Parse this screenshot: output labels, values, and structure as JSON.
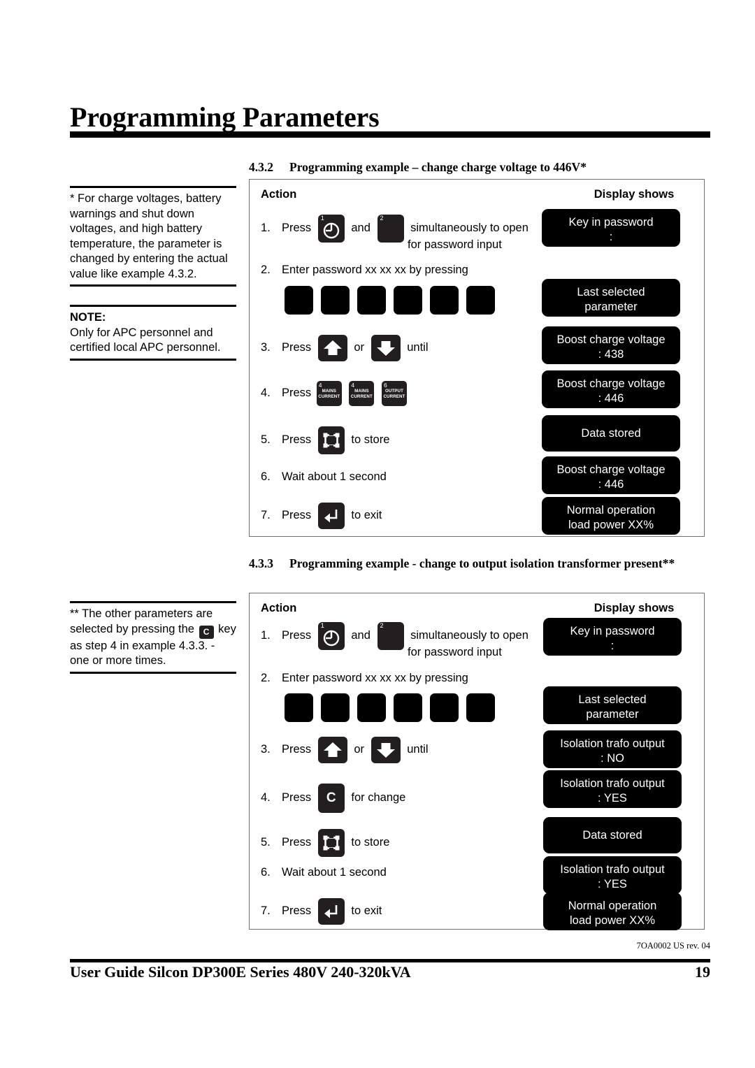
{
  "header": {
    "title": "Programming Parameters"
  },
  "side_notes": [
    {
      "id": "note-1",
      "text": "* For charge voltages, battery warnings and shut down voltages, and high battery temperature, the parameter is changed by entering the actual value like example 4.3.2."
    },
    {
      "id": "note-2",
      "label": "NOTE:",
      "text": "Only for APC personnel and certified local APC personnel."
    },
    {
      "id": "note-3",
      "text_before": "** The other parameters are selected by pressing the",
      "key_label": "C",
      "text_after": "key as step 4 in example 4.3.3. - one or more times."
    }
  ],
  "sections": [
    {
      "number": "4.3.2",
      "title": "Programming example – change charge voltage to 446V*"
    },
    {
      "number": "4.3.3",
      "title": "Programming example - change to output isolation transformer present**"
    }
  ],
  "table_headers": {
    "action": "Action",
    "display": "Display shows"
  },
  "table_432": {
    "steps": [
      {
        "num": "1.",
        "verb": "Press",
        "keys": [
          "power-clock-key-1",
          "blank-key-2"
        ],
        "conjunction": "and",
        "text_after": "simultaneously to open",
        "text_second_line": "for password input"
      },
      {
        "num": "2.",
        "text": "Enter password xx xx xx by pressing",
        "password_keys": 6
      },
      {
        "num": "3.",
        "verb": "Press",
        "keys": [
          "arrow-up-key",
          "arrow-down-key"
        ],
        "conjunction": "or",
        "text_after": "until"
      },
      {
        "num": "4.",
        "verb": "Press",
        "function_keys": [
          {
            "number": "4",
            "line1": "MAINS",
            "line2": "CURRENT"
          },
          {
            "number": "4",
            "line1": "MAINS",
            "line2": "CURRENT"
          },
          {
            "number": "6",
            "line1": "OUTPUT",
            "line2": "CURRENT"
          }
        ]
      },
      {
        "num": "5.",
        "verb": "Press",
        "keys": [
          "store-key"
        ],
        "text_after": "to store"
      },
      {
        "num": "6.",
        "text": "Wait about 1 second"
      },
      {
        "num": "7.",
        "verb": "Press",
        "keys": [
          "enter-key"
        ],
        "text_after": "to exit"
      }
    ],
    "displays": [
      {
        "line1": "Key in password",
        "line2": ":"
      },
      {
        "line1": "Last selected",
        "line2": "parameter"
      },
      {
        "line1": "Boost charge voltage",
        "line2": ": 438"
      },
      {
        "line1": "Boost charge voltage",
        "line2": ": 446"
      },
      {
        "line1": "Data stored",
        "line2": ""
      },
      {
        "line1": "Boost charge voltage",
        "line2": ": 446"
      },
      {
        "line1": "Normal operation",
        "line2": "load power XX%"
      }
    ]
  },
  "table_433": {
    "steps": [
      {
        "num": "1.",
        "verb": "Press",
        "keys": [
          "power-clock-key-1",
          "blank-key-2"
        ],
        "conjunction": "and",
        "text_after": "simultaneously to open",
        "text_second_line": "for password input"
      },
      {
        "num": "2.",
        "text": "Enter password xx xx xx by pressing",
        "password_keys": 6
      },
      {
        "num": "3.",
        "verb": "Press",
        "keys": [
          "arrow-up-key",
          "arrow-down-key"
        ],
        "conjunction": "or",
        "text_after": "until"
      },
      {
        "num": "4.",
        "verb": "Press",
        "keys": [
          "c-key"
        ],
        "text_after": "for change"
      },
      {
        "num": "5.",
        "verb": "Press",
        "keys": [
          "store-key"
        ],
        "text_after": "to store"
      },
      {
        "num": "6.",
        "text": "Wait about 1 second"
      },
      {
        "num": "7.",
        "verb": "Press",
        "keys": [
          "enter-key"
        ],
        "text_after": "to exit"
      }
    ],
    "displays": [
      {
        "line1": "Key in password",
        "line2": ":"
      },
      {
        "line1": "Last selected",
        "line2": "parameter"
      },
      {
        "line1": "Isolation trafo output",
        "line2": ": NO"
      },
      {
        "line1": "Isolation trafo output",
        "line2": ": YES"
      },
      {
        "line1": "Data stored",
        "line2": ""
      },
      {
        "line1": "Isolation trafo output",
        "line2": ": YES"
      },
      {
        "line1": "Normal operation",
        "line2": "load power XX%"
      }
    ]
  },
  "footer": {
    "doc_rev": "7OA0002 US rev. 04",
    "guide_title": "User Guide Silcon DP300E Series 480V 240-320kVA",
    "page_number": "19"
  },
  "colors": {
    "key_black": "#231f20",
    "lcd_black": "#000000",
    "table_border": "#6f6f6f"
  }
}
